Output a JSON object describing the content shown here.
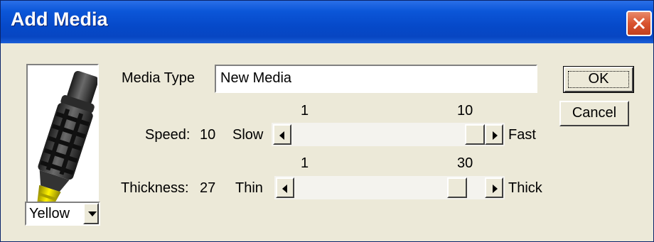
{
  "window": {
    "title": "Add Media",
    "close_icon": "close-icon"
  },
  "media_color": {
    "selected": "Yellow",
    "options": [
      "Yellow"
    ]
  },
  "media_type": {
    "label": "Media Type",
    "value": "New Media"
  },
  "speed": {
    "label": "Speed:",
    "value": "10",
    "min_label": "Slow",
    "max_label": "Fast",
    "range_min": "1",
    "range_max": "10",
    "position": 10,
    "min": 1,
    "max": 10
  },
  "thickness": {
    "label": "Thickness:",
    "value": "27",
    "min_label": "Thin",
    "max_label": "Thick",
    "range_min": "1",
    "range_max": "30",
    "position": 27,
    "min": 1,
    "max": 30
  },
  "buttons": {
    "ok": "OK",
    "cancel": "Cancel"
  },
  "colors": {
    "titlebar": "#0649c9",
    "face": "#ece9d8",
    "close": "#d9532f",
    "media_tip": "#f2e600"
  }
}
